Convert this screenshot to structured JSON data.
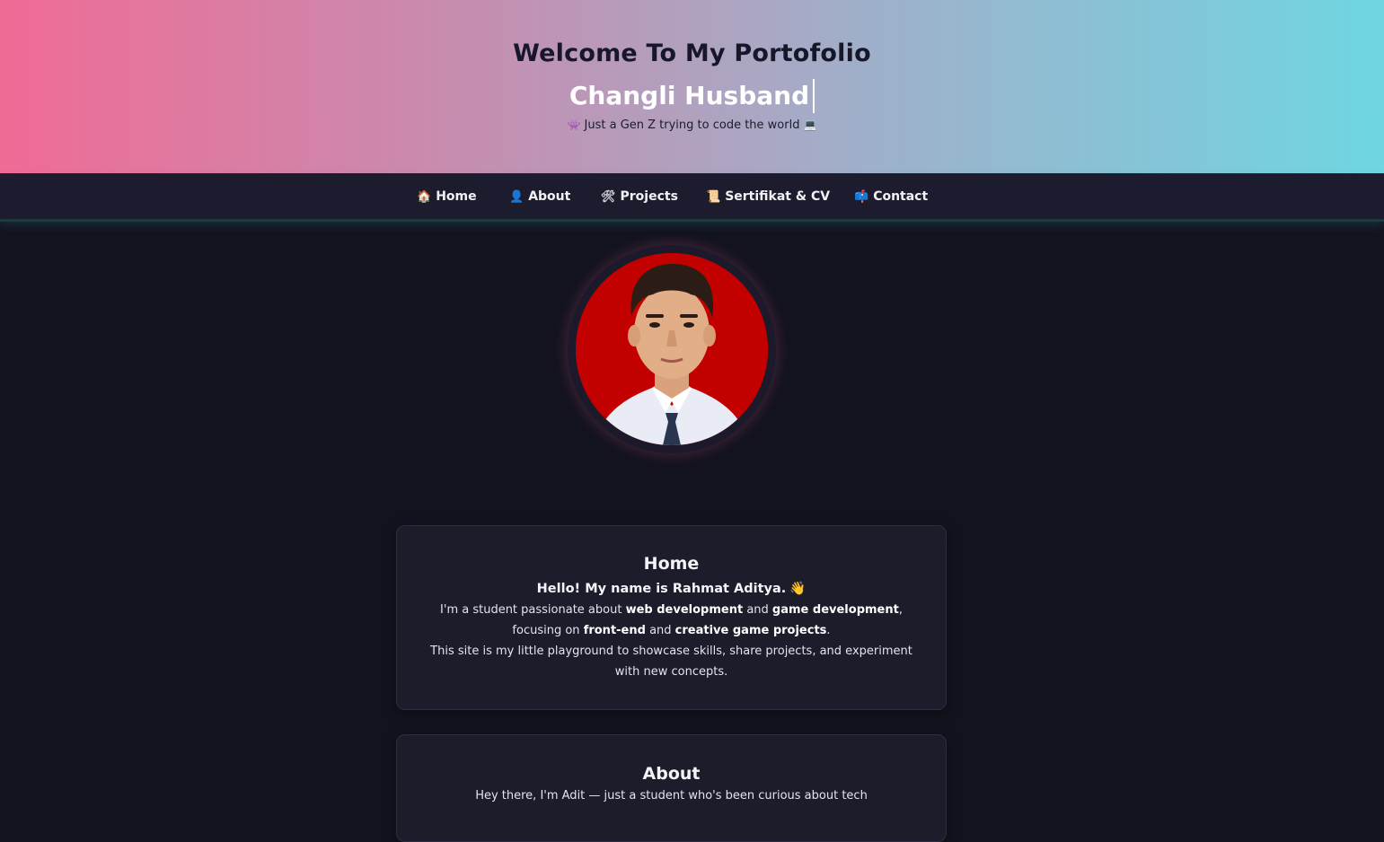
{
  "hero": {
    "title": "Welcome To My Portofolio",
    "name": "Changli Husband",
    "tagline": "Just a Gen Z trying to code the world",
    "tagline_icons": [
      "alien-icon",
      "laptop-icon"
    ]
  },
  "nav": {
    "items": [
      {
        "label": "Home",
        "icon": "house-icon"
      },
      {
        "label": "About",
        "icon": "person-icon"
      },
      {
        "label": "Projects",
        "icon": "tools-icon"
      },
      {
        "label": "Sertifikat & CV",
        "icon": "scroll-icon"
      },
      {
        "label": "Contact",
        "icon": "mailbox-icon"
      }
    ]
  },
  "home": {
    "title": "Home",
    "hello": "Hello! My name is Rahmat Aditya.",
    "p1_a": "I'm a student passionate about ",
    "p1_b": "web development",
    "p1_c": " and ",
    "p1_d": "game development",
    "p1_e": ",",
    "p2_a": "focusing on ",
    "p2_b": "front-end",
    "p2_c": " and ",
    "p2_d": "creative game projects",
    "p2_e": ".",
    "p3": "This site is my little playground to showcase skills, share projects, and experiment with new concepts."
  },
  "about": {
    "title": "About",
    "text": "Hey there, I'm Adit — just a student who's been curious about tech"
  },
  "colors": {
    "gradient_start": "#f06b96",
    "gradient_end": "#6fd6e2",
    "background": "#13131f",
    "nav_bg": "#1c1c2e",
    "card_bg": "#1c1c2b",
    "avatar_bg": "#c80000"
  }
}
